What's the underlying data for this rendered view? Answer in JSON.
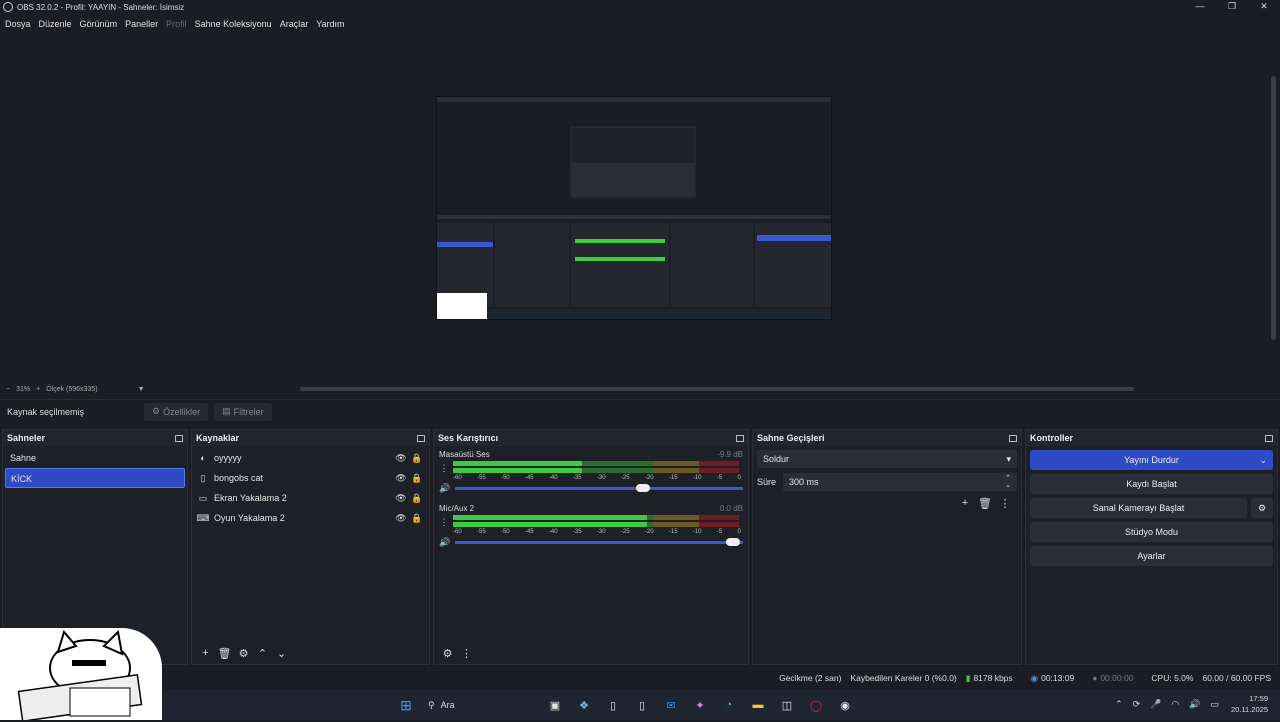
{
  "window": {
    "title": "OBS 32.0.2 - Profil: YAAYIN - Sahneler: İsimsiz",
    "controls": [
      "—",
      "❐",
      "✕"
    ]
  },
  "menu": [
    "Dosya",
    "Düzenle",
    "Görünüm",
    "Paneller",
    "Profil",
    "Sahne Koleksiyonu",
    "Araçlar",
    "Yardım"
  ],
  "zoom": {
    "minus": "−",
    "value": "31%",
    "plus": "+",
    "scale_label": "Ölçek (596x335)"
  },
  "context_bar": {
    "no_source": "Kaynak seçilmemiş",
    "properties": "Özellikler",
    "filters": "Filtreler"
  },
  "scenes": {
    "title": "Sahneler",
    "items": [
      "Sahne",
      "KİCK"
    ],
    "selected": 1
  },
  "sources": {
    "title": "Kaynaklar",
    "items": [
      {
        "name": "oyyyyy",
        "icon": "◐"
      },
      {
        "name": "bongobs cat",
        "icon": "▯"
      },
      {
        "name": "Ekran Yakalama 2",
        "icon": "▭"
      },
      {
        "name": "Oyun Yakalama 2",
        "icon": "⌨"
      }
    ]
  },
  "mixer": {
    "title": "Ses Karıştırıcı",
    "channels": [
      {
        "name": "Masaüstü Ses",
        "db": "-9.9 dB",
        "level": 0.45,
        "volume": 0.66
      },
      {
        "name": "Mic/Aux 2",
        "db": "0.0 dB",
        "level": 0.68,
        "volume": 0.97
      }
    ],
    "scale": [
      "-60",
      "-55",
      "-50",
      "-45",
      "-40",
      "-35",
      "-30",
      "-25",
      "-20",
      "-15",
      "-10",
      "-5",
      "0"
    ]
  },
  "transitions": {
    "title": "Sahne Geçişleri",
    "selected": "Soldur",
    "duration_label": "Süre",
    "duration_value": "300 ms"
  },
  "controls": {
    "title": "Kontroller",
    "stop_stream": "Yayını Durdur",
    "start_record": "Kaydı Başlat",
    "start_vcam": "Sanal Kamerayı Başlat",
    "studio_mode": "Stüdyo Modu",
    "settings": "Ayarlar"
  },
  "status": {
    "delay": "Gecikme (2 san)",
    "dropped": "Kaybedilen Kareler 0 (%0.0)",
    "bitrate": "8178 kbps",
    "stream_time": "00:13:09",
    "record_time": "00:00:00",
    "cpu": "CPU: 5.0%",
    "fps": "60.00 / 60.00 FPS"
  },
  "taskbar": {
    "search": "Ara",
    "time": "17:59",
    "date": "20.11.2025"
  },
  "colors": {
    "accent": "#2e4ac4",
    "meter_green": "#3ccc3c",
    "meter_yellow": "#d6a23a",
    "meter_red": "#c0303a"
  }
}
